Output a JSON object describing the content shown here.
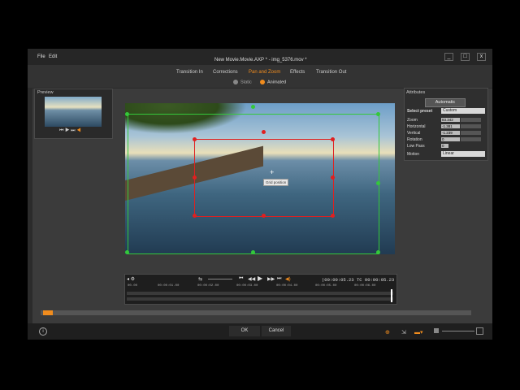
{
  "menu": {
    "file": "File",
    "edit": "Edit"
  },
  "window": {
    "title": "New Movie.Movie.AXP * - img_5376.mov *",
    "minimize": "_",
    "maximize": "□",
    "close": "x"
  },
  "tabs": [
    {
      "label": "Transition In"
    },
    {
      "label": "Corrections"
    },
    {
      "label": "Pan and Zoom"
    },
    {
      "label": "Effects"
    },
    {
      "label": "Transition Out"
    }
  ],
  "modes": {
    "static": "Static",
    "animated": "Animated"
  },
  "preview": {
    "title": "Preview"
  },
  "canvas": {
    "tooltip": "Grid position"
  },
  "timeline": {
    "timecode_left": "|00:00:05.23",
    "timecode_right": "TC 00:00:05.23",
    "ticks": [
      "00.00",
      "00:00:01.00",
      "00:00:02.00",
      "00:00:03.00",
      "00:00:04.00",
      "00:00:05.00",
      "00:00:06.00"
    ]
  },
  "attributes": {
    "title": "Attributes",
    "automatic": "Automatic",
    "preset_label": "Select preset",
    "preset_value": "Custom",
    "zoom_label": "Zoom",
    "zoom_value": "83.342",
    "horizontal_label": "Horizontal",
    "horizontal_value": "-1.381",
    "vertical_label": "Vertical",
    "vertical_value": "-1.239",
    "rotation_label": "Rotation",
    "rotation_value": "0",
    "lowpass_label": "Low Pass",
    "lowpass_value": "0",
    "motion_label": "Motion",
    "motion_value": "Linear"
  },
  "footer": {
    "ok": "OK",
    "cancel": "Cancel"
  },
  "colors": {
    "accent": "#f08c1e",
    "start_frame": "#34c83a",
    "end_frame": "#e02020"
  }
}
